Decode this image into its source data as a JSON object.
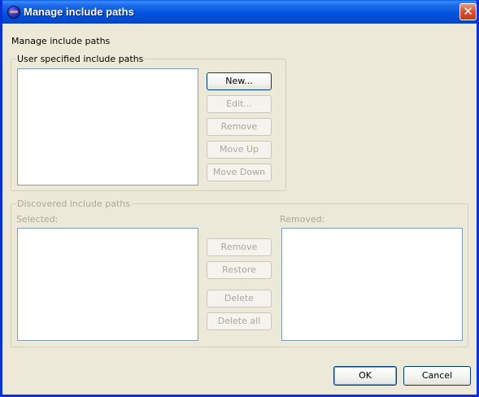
{
  "window": {
    "title": "Manage include paths",
    "close_label": "✕"
  },
  "intro": "Manage include paths",
  "user_group": {
    "legend": "User specified include paths",
    "buttons": {
      "new": "New...",
      "edit": "Edit...",
      "remove": "Remove",
      "move_up": "Move Up",
      "move_down": "Move Down"
    }
  },
  "discovered_group": {
    "legend": "Discovered include paths",
    "selected_label": "Selected:",
    "removed_label": "Removed:",
    "buttons": {
      "remove": "Remove",
      "restore": "Restore",
      "delete": "Delete",
      "delete_all": "Delete all"
    }
  },
  "footer": {
    "ok": "OK",
    "cancel": "Cancel"
  }
}
